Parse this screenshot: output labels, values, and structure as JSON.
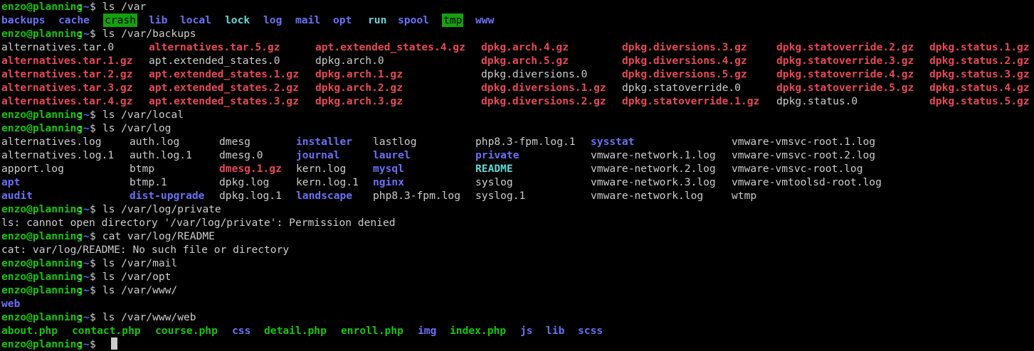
{
  "prompt": {
    "user_host": "enzo@planning",
    "path": "~",
    "sep": ":",
    "symbol": "$"
  },
  "commands": [
    "ls /var",
    "ls /var/backups",
    "ls /var/local",
    "ls /var/log",
    "ls /var/log/private",
    "cat var/log/README",
    "ls /var/mail",
    "ls /var/opt",
    "ls /var/www/",
    "ls /var/www/web"
  ],
  "var_listing": [
    "backups",
    "cache",
    "crash",
    "lib",
    "local",
    "lock",
    "log",
    "mail",
    "opt",
    "run",
    "spool",
    "tmp",
    "www"
  ],
  "backups_listing": [
    [
      "alternatives.tar.0",
      "alternatives.tar.5.gz",
      "apt.extended_states.4.gz",
      "dpkg.arch.4.gz",
      "dpkg.diversions.3.gz",
      "dpkg.statoverride.2.gz",
      "dpkg.status.1.gz"
    ],
    [
      "alternatives.tar.1.gz",
      "apt.extended_states.0",
      "dpkg.arch.0",
      "dpkg.arch.5.gz",
      "dpkg.diversions.4.gz",
      "dpkg.statoverride.3.gz",
      "dpkg.status.2.gz"
    ],
    [
      "alternatives.tar.2.gz",
      "apt.extended_states.1.gz",
      "dpkg.arch.1.gz",
      "dpkg.diversions.0",
      "dpkg.diversions.5.gz",
      "dpkg.statoverride.4.gz",
      "dpkg.status.3.gz"
    ],
    [
      "alternatives.tar.3.gz",
      "apt.extended_states.2.gz",
      "dpkg.arch.2.gz",
      "dpkg.diversions.1.gz",
      "dpkg.statoverride.0",
      "dpkg.statoverride.5.gz",
      "dpkg.status.4.gz"
    ],
    [
      "alternatives.tar.4.gz",
      "apt.extended_states.3.gz",
      "dpkg.arch.3.gz",
      "dpkg.diversions.2.gz",
      "dpkg.statoverride.1.gz",
      "dpkg.status.0",
      "dpkg.status.5.gz"
    ]
  ],
  "log_listing": [
    [
      "alternatives.log",
      "auth.log",
      "dmesg",
      "installer",
      "lastlog",
      "php8.3-fpm.log.1",
      "sysstat",
      "vmware-vmsvc-root.1.log"
    ],
    [
      "alternatives.log.1",
      "auth.log.1",
      "dmesg.0",
      "journal",
      "laurel",
      "private",
      "vmware-network.1.log",
      "vmware-vmsvc-root.2.log"
    ],
    [
      "apport.log",
      "btmp",
      "dmesg.1.gz",
      "kern.log",
      "mysql",
      "README",
      "vmware-network.2.log",
      "vmware-vmsvc-root.log"
    ],
    [
      "apt",
      "btmp.1",
      "dpkg.log",
      "kern.log.1",
      "nginx",
      "syslog",
      "vmware-network.3.log",
      "vmware-vmtoolsd-root.log"
    ],
    [
      "audit",
      "dist-upgrade",
      "dpkg.log.1",
      "landscape",
      "php8.3-fpm.log",
      "syslog.1",
      "vmware-network.log",
      "wtmp"
    ]
  ],
  "errors": {
    "private_denied": "ls: cannot open directory '/var/log/private': Permission denied",
    "readme_missing": "cat: var/log/README: No such file or directory"
  },
  "www_listing": [
    "web"
  ],
  "web_listing": [
    "about.php",
    "contact.php",
    "course.php",
    "css",
    "detail.php",
    "enroll.php",
    "img",
    "index.php",
    "js",
    "lib",
    "scss"
  ],
  "colors": {
    "background": "#000000",
    "text": "#cccccc",
    "prompt_user": "#16c60c",
    "prompt_path": "#3b78ff",
    "directory": "#6a70f5",
    "archive": "#e74856",
    "highlight_bg": "#13a10e",
    "cyan": "#61d6d6"
  }
}
